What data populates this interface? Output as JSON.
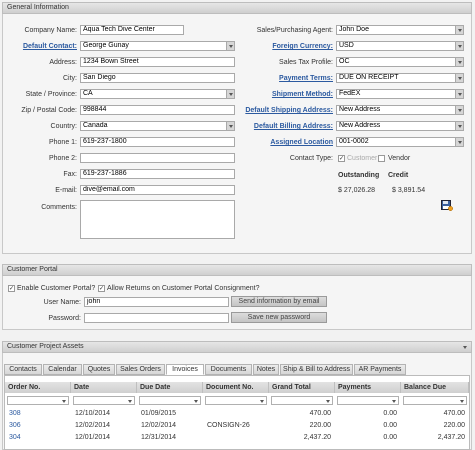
{
  "general": {
    "header": "General Information",
    "company_name_label": "Company Name:",
    "company_name": "Aqua Tech Dive Center",
    "default_contact_label": "Default Contact:",
    "default_contact": "George Gunay",
    "address_label": "Address:",
    "address": "1234 Bown Street",
    "city_label": "City:",
    "city": "San Diego",
    "state_label": "State / Province:",
    "state": "CA",
    "zip_label": "Zip / Postal Code:",
    "zip": "998844",
    "country_label": "Country:",
    "country": "Canada",
    "phone1_label": "Phone 1:",
    "phone1": "619-237-1800",
    "phone2_label": "Phone 2:",
    "phone2": "",
    "fax_label": "Fax:",
    "fax": "619-237-1886",
    "email_label": "E-mail:",
    "email": "dive@email.com",
    "comments_label": "Comments:",
    "comments": "",
    "sales_agent_label": "Sales/Purchasing Agent:",
    "sales_agent": "John Doe",
    "foreign_currency_label": "Foreign Currency:",
    "foreign_currency": "USD",
    "sales_tax_label": "Sales Tax Profile:",
    "sales_tax": "OC",
    "payment_terms_label": "Payment Terms:",
    "payment_terms": "DUE ON RECEIPT",
    "shipment_method_label": "Shipment Method:",
    "shipment_method": "FedEX",
    "default_shipping_label": "Default Shipping Address:",
    "default_shipping": "New Address",
    "default_billing_label": "Default Billing Address:",
    "default_billing": "New Address",
    "assigned_location_label": "Assigned Location",
    "assigned_location": "001-0002",
    "contact_type_label": "Contact Type:",
    "customer_label": "Customer",
    "vendor_label": "Vendor",
    "outstanding_label": "Outstanding",
    "credit_label": "Credit",
    "outstanding_value": "$ 27,026.28",
    "credit_value": "$ 3,891.54",
    "save_icon": "save-icon"
  },
  "portal": {
    "header": "Customer Portal",
    "enable_label": "Enable Customer Portal?",
    "allow_returns_label": "Allow Returns on Customer Portal Consignment?",
    "user_name_label": "User Name:",
    "user_name": "john",
    "password_label": "Password:",
    "password": "",
    "send_info_button": "Send information by email",
    "save_password_button": "Save new password"
  },
  "assets": {
    "header": "Customer Project Assets",
    "tabs": [
      "Contacts",
      "Calendar",
      "Quotes",
      "Sales Orders",
      "Invoices",
      "Documents",
      "Notes",
      "Ship & Bill to Address",
      "AR Payments"
    ],
    "active_tab": "Invoices",
    "columns": [
      "Order No.",
      "Date",
      "Due Date",
      "Document No.",
      "Grand Total",
      "Payments",
      "Balance Due"
    ],
    "rows": [
      [
        "308",
        "12/10/2014",
        "01/09/2015",
        "",
        "470.00",
        "0.00",
        "470.00"
      ],
      [
        "306",
        "12/02/2014",
        "12/02/2014",
        "CONSIGN-26",
        "220.00",
        "0.00",
        "220.00"
      ],
      [
        "304",
        "12/01/2014",
        "12/31/2014",
        "",
        "2,437.20",
        "0.00",
        "2,437.20"
      ]
    ]
  }
}
